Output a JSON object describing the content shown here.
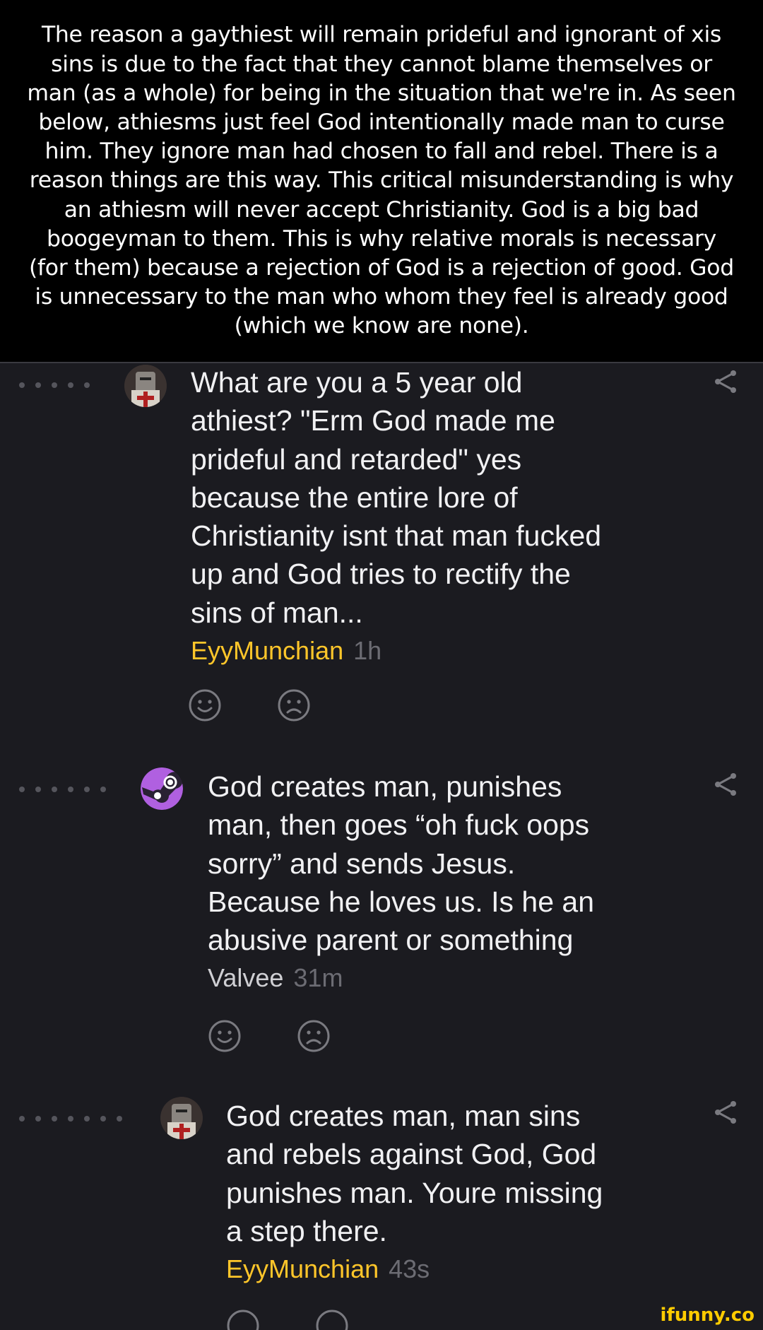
{
  "caption": "The reason a gaythiest will remain prideful and ignorant of xis sins is due to the fact that they cannot blame themselves or man (as a whole) for being in the situation that we're in. As seen below, athiesms just feel God intentionally made man to curse him. They ignore man had chosen to fall and rebel. There is a reason things are this way. This critical misunderstanding is why an athiesm will never accept Christianity. God is a big bad boogeyman to them. This is why relative morals is necessary (for them) because a rejection of God is a rejection of good. God is unnecessary to the man who whom they feel is already good (which we know are none).",
  "comments": [
    {
      "text": "What are you a 5 year old\nathiest? \"Erm God made me\nprideful and retarded\" yes\nbecause the entire lore of\nChristianity isnt that man fucked\nup and God tries to rectify the\nsins of man...",
      "author": "EyyMunchian",
      "time": "1h",
      "depth": 5,
      "avatar_icon": "knight-avatar-icon",
      "author_color": "#ffc62a"
    },
    {
      "text": "God creates man, punishes\nman, then goes “oh fuck oops\nsorry” and sends Jesus.\nBecause he loves us. Is he an\nabusive parent or something",
      "author": "Valvee",
      "time": "31m",
      "depth": 6,
      "avatar_icon": "steam-avatar-icon",
      "author_color": "#cfcfd3"
    },
    {
      "text": "God creates man, man sins\nand rebels against God, God\npunishes man. Youre missing\na step there.",
      "author": "EyyMunchian",
      "time": "43s",
      "depth": 7,
      "avatar_icon": "knight-avatar-icon",
      "author_color": "#ffc62a"
    }
  ],
  "icons": {
    "smile": "smile-icon",
    "frown": "frown-icon",
    "share": "share-icon"
  },
  "watermark": "ifunny.co"
}
